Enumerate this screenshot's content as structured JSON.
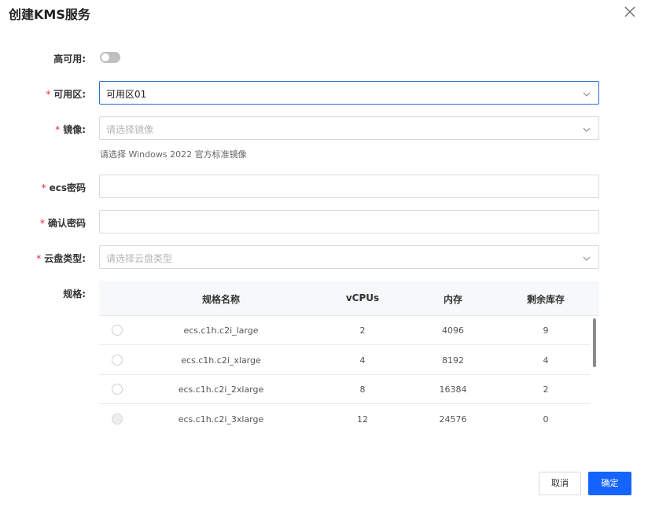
{
  "dialog": {
    "title": "创建KMS服务"
  },
  "form": {
    "ha": {
      "label": "高可用:",
      "enabled": false
    },
    "zone": {
      "label": "可用区:",
      "value": "可用区01"
    },
    "image": {
      "label": "镜像:",
      "placeholder": "请选择镜像",
      "hint": "请选择 Windows 2022 官方标准镜像"
    },
    "ecs_password": {
      "label": "ecs密码",
      "value": ""
    },
    "confirm_password": {
      "label": "确认密码",
      "value": ""
    },
    "disk_type": {
      "label": "云盘类型:",
      "placeholder": "请选择云盘类型"
    },
    "spec": {
      "label": "规格:",
      "columns": [
        "规格名称",
        "vCPUs",
        "内存",
        "剩余库存"
      ],
      "rows": [
        {
          "name": "ecs.c1h.c2i_large",
          "vcpus": "2",
          "memory": "4096",
          "stock": "9"
        },
        {
          "name": "ecs.c1h.c2i_xlarge",
          "vcpus": "4",
          "memory": "8192",
          "stock": "4"
        },
        {
          "name": "ecs.c1h.c2i_2xlarge",
          "vcpus": "8",
          "memory": "16384",
          "stock": "2"
        },
        {
          "name": "ecs.c1h.c2i_3xlarge",
          "vcpus": "12",
          "memory": "24576",
          "stock": "0"
        }
      ]
    }
  },
  "footer": {
    "cancel_label": "取消",
    "ok_label": "确定"
  },
  "colors": {
    "primary": "#1664ff",
    "required": "#f5222d",
    "focus_border": "#2b6cd6"
  }
}
